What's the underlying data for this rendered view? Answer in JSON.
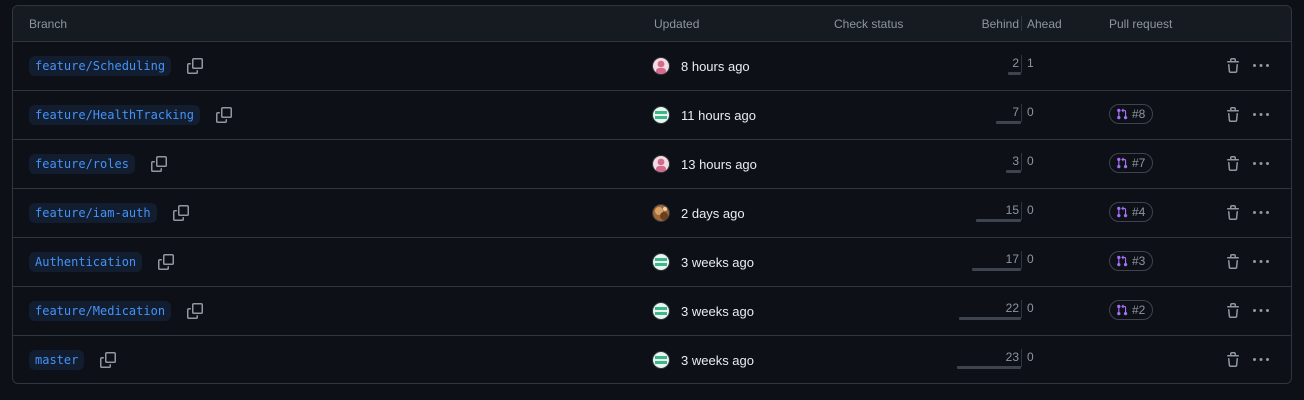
{
  "header": {
    "branch": "Branch",
    "updated": "Updated",
    "check_status": "Check status",
    "behind": "Behind",
    "ahead": "Ahead",
    "pull_request": "Pull request"
  },
  "rows": [
    {
      "branch": "feature/Scheduling",
      "avatar": "pink",
      "updated": "8 hours ago",
      "behind": "2",
      "ahead": "1",
      "pr": ""
    },
    {
      "branch": "feature/HealthTracking",
      "avatar": "green",
      "updated": "11 hours ago",
      "behind": "7",
      "ahead": "0",
      "pr": "#8"
    },
    {
      "branch": "feature/roles",
      "avatar": "pink",
      "updated": "13 hours ago",
      "behind": "3",
      "ahead": "0",
      "pr": "#7"
    },
    {
      "branch": "feature/iam-auth",
      "avatar": "photo",
      "updated": "2 days ago",
      "behind": "15",
      "ahead": "0",
      "pr": "#4"
    },
    {
      "branch": "Authentication",
      "avatar": "green",
      "updated": "3 weeks ago",
      "behind": "17",
      "ahead": "0",
      "pr": "#3"
    },
    {
      "branch": "feature/Medication",
      "avatar": "green",
      "updated": "3 weeks ago",
      "behind": "22",
      "ahead": "0",
      "pr": "#2"
    },
    {
      "branch": "master",
      "avatar": "green",
      "updated": "3 weeks ago",
      "behind": "23",
      "ahead": "0",
      "pr": ""
    }
  ],
  "icons": {
    "copy": "copy-icon",
    "pull_request": "git-pull-request-icon",
    "delete": "trash-icon",
    "more": "kebab-horizontal-icon"
  },
  "colors": {
    "link": "#4493f8",
    "pr_icon": "#a371f7",
    "muted": "#8d96a0"
  }
}
